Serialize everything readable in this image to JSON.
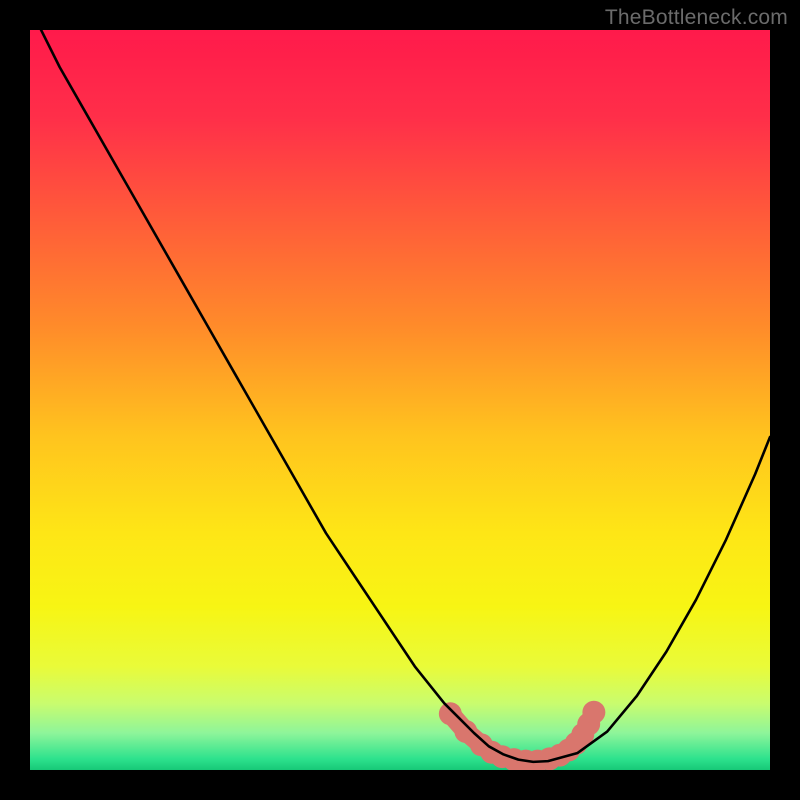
{
  "watermark": "TheBottleneck.com",
  "colors": {
    "black": "#000000",
    "curve": "#000000",
    "highlight": "#d9766d"
  },
  "gradient_stops": [
    {
      "offset": 0.0,
      "color": "#ff1a4b"
    },
    {
      "offset": 0.12,
      "color": "#ff2f49"
    },
    {
      "offset": 0.25,
      "color": "#ff5a3a"
    },
    {
      "offset": 0.4,
      "color": "#ff8b2a"
    },
    {
      "offset": 0.55,
      "color": "#ffc41e"
    },
    {
      "offset": 0.68,
      "color": "#fee616"
    },
    {
      "offset": 0.78,
      "color": "#f7f514"
    },
    {
      "offset": 0.86,
      "color": "#e9fb39"
    },
    {
      "offset": 0.91,
      "color": "#c9fc6e"
    },
    {
      "offset": 0.95,
      "color": "#8ef59a"
    },
    {
      "offset": 0.985,
      "color": "#2de28d"
    },
    {
      "offset": 1.0,
      "color": "#17c877"
    }
  ],
  "chart_data": {
    "type": "line",
    "title": "",
    "xlabel": "",
    "ylabel": "",
    "xlim": [
      0,
      100
    ],
    "ylim": [
      0,
      100
    ],
    "grid": false,
    "series": [
      {
        "name": "bottleneck-curve",
        "x": [
          0,
          4,
          8,
          12,
          16,
          20,
          24,
          28,
          32,
          36,
          40,
          44,
          48,
          52,
          56,
          58,
          60,
          62,
          64,
          66,
          68,
          70,
          74,
          78,
          82,
          86,
          90,
          94,
          98,
          100
        ],
        "y": [
          103,
          95,
          88,
          81,
          74,
          67,
          60,
          53,
          46,
          39,
          32,
          26,
          20,
          14,
          9,
          7,
          5,
          3.2,
          2.1,
          1.4,
          1.1,
          1.2,
          2.3,
          5.2,
          10,
          16,
          23,
          31,
          40,
          45
        ]
      }
    ],
    "highlight": {
      "name": "sweet-spot",
      "points": [
        {
          "x": 56.8,
          "y": 7.6
        },
        {
          "x": 58.9,
          "y": 5.2
        },
        {
          "x": 61.0,
          "y": 3.4
        },
        {
          "x": 62.4,
          "y": 2.4
        },
        {
          "x": 63.8,
          "y": 1.8
        },
        {
          "x": 65.4,
          "y": 1.4
        },
        {
          "x": 67.0,
          "y": 1.2
        },
        {
          "x": 68.6,
          "y": 1.2
        },
        {
          "x": 70.2,
          "y": 1.5
        },
        {
          "x": 71.6,
          "y": 2.0
        },
        {
          "x": 72.8,
          "y": 2.7
        },
        {
          "x": 73.8,
          "y": 3.6
        },
        {
          "x": 74.7,
          "y": 4.8
        },
        {
          "x": 75.5,
          "y": 6.2
        },
        {
          "x": 76.2,
          "y": 7.8
        }
      ]
    }
  }
}
